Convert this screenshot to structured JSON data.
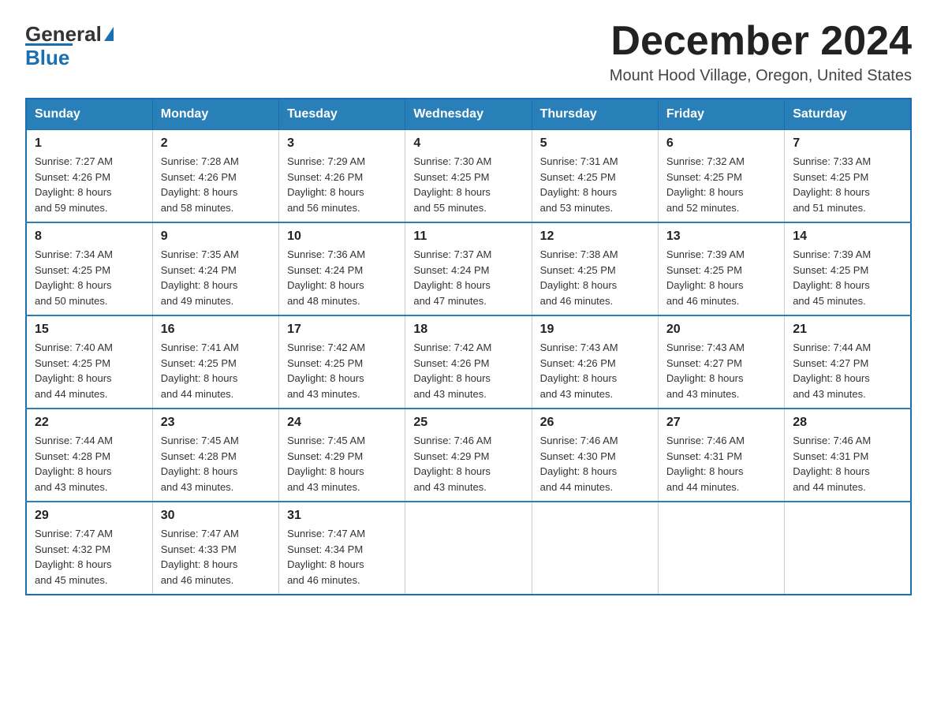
{
  "header": {
    "logo_general": "General",
    "logo_blue": "Blue",
    "month": "December 2024",
    "location": "Mount Hood Village, Oregon, United States"
  },
  "days_of_week": [
    "Sunday",
    "Monday",
    "Tuesday",
    "Wednesday",
    "Thursday",
    "Friday",
    "Saturday"
  ],
  "weeks": [
    [
      {
        "day": "1",
        "sunrise": "7:27 AM",
        "sunset": "4:26 PM",
        "daylight": "8 hours and 59 minutes."
      },
      {
        "day": "2",
        "sunrise": "7:28 AM",
        "sunset": "4:26 PM",
        "daylight": "8 hours and 58 minutes."
      },
      {
        "day": "3",
        "sunrise": "7:29 AM",
        "sunset": "4:26 PM",
        "daylight": "8 hours and 56 minutes."
      },
      {
        "day": "4",
        "sunrise": "7:30 AM",
        "sunset": "4:25 PM",
        "daylight": "8 hours and 55 minutes."
      },
      {
        "day": "5",
        "sunrise": "7:31 AM",
        "sunset": "4:25 PM",
        "daylight": "8 hours and 53 minutes."
      },
      {
        "day": "6",
        "sunrise": "7:32 AM",
        "sunset": "4:25 PM",
        "daylight": "8 hours and 52 minutes."
      },
      {
        "day": "7",
        "sunrise": "7:33 AM",
        "sunset": "4:25 PM",
        "daylight": "8 hours and 51 minutes."
      }
    ],
    [
      {
        "day": "8",
        "sunrise": "7:34 AM",
        "sunset": "4:25 PM",
        "daylight": "8 hours and 50 minutes."
      },
      {
        "day": "9",
        "sunrise": "7:35 AM",
        "sunset": "4:24 PM",
        "daylight": "8 hours and 49 minutes."
      },
      {
        "day": "10",
        "sunrise": "7:36 AM",
        "sunset": "4:24 PM",
        "daylight": "8 hours and 48 minutes."
      },
      {
        "day": "11",
        "sunrise": "7:37 AM",
        "sunset": "4:24 PM",
        "daylight": "8 hours and 47 minutes."
      },
      {
        "day": "12",
        "sunrise": "7:38 AM",
        "sunset": "4:25 PM",
        "daylight": "8 hours and 46 minutes."
      },
      {
        "day": "13",
        "sunrise": "7:39 AM",
        "sunset": "4:25 PM",
        "daylight": "8 hours and 46 minutes."
      },
      {
        "day": "14",
        "sunrise": "7:39 AM",
        "sunset": "4:25 PM",
        "daylight": "8 hours and 45 minutes."
      }
    ],
    [
      {
        "day": "15",
        "sunrise": "7:40 AM",
        "sunset": "4:25 PM",
        "daylight": "8 hours and 44 minutes."
      },
      {
        "day": "16",
        "sunrise": "7:41 AM",
        "sunset": "4:25 PM",
        "daylight": "8 hours and 44 minutes."
      },
      {
        "day": "17",
        "sunrise": "7:42 AM",
        "sunset": "4:25 PM",
        "daylight": "8 hours and 43 minutes."
      },
      {
        "day": "18",
        "sunrise": "7:42 AM",
        "sunset": "4:26 PM",
        "daylight": "8 hours and 43 minutes."
      },
      {
        "day": "19",
        "sunrise": "7:43 AM",
        "sunset": "4:26 PM",
        "daylight": "8 hours and 43 minutes."
      },
      {
        "day": "20",
        "sunrise": "7:43 AM",
        "sunset": "4:27 PM",
        "daylight": "8 hours and 43 minutes."
      },
      {
        "day": "21",
        "sunrise": "7:44 AM",
        "sunset": "4:27 PM",
        "daylight": "8 hours and 43 minutes."
      }
    ],
    [
      {
        "day": "22",
        "sunrise": "7:44 AM",
        "sunset": "4:28 PM",
        "daylight": "8 hours and 43 minutes."
      },
      {
        "day": "23",
        "sunrise": "7:45 AM",
        "sunset": "4:28 PM",
        "daylight": "8 hours and 43 minutes."
      },
      {
        "day": "24",
        "sunrise": "7:45 AM",
        "sunset": "4:29 PM",
        "daylight": "8 hours and 43 minutes."
      },
      {
        "day": "25",
        "sunrise": "7:46 AM",
        "sunset": "4:29 PM",
        "daylight": "8 hours and 43 minutes."
      },
      {
        "day": "26",
        "sunrise": "7:46 AM",
        "sunset": "4:30 PM",
        "daylight": "8 hours and 44 minutes."
      },
      {
        "day": "27",
        "sunrise": "7:46 AM",
        "sunset": "4:31 PM",
        "daylight": "8 hours and 44 minutes."
      },
      {
        "day": "28",
        "sunrise": "7:46 AM",
        "sunset": "4:31 PM",
        "daylight": "8 hours and 44 minutes."
      }
    ],
    [
      {
        "day": "29",
        "sunrise": "7:47 AM",
        "sunset": "4:32 PM",
        "daylight": "8 hours and 45 minutes."
      },
      {
        "day": "30",
        "sunrise": "7:47 AM",
        "sunset": "4:33 PM",
        "daylight": "8 hours and 46 minutes."
      },
      {
        "day": "31",
        "sunrise": "7:47 AM",
        "sunset": "4:34 PM",
        "daylight": "8 hours and 46 minutes."
      },
      null,
      null,
      null,
      null
    ]
  ],
  "labels": {
    "sunrise": "Sunrise:",
    "sunset": "Sunset:",
    "daylight": "Daylight:"
  }
}
